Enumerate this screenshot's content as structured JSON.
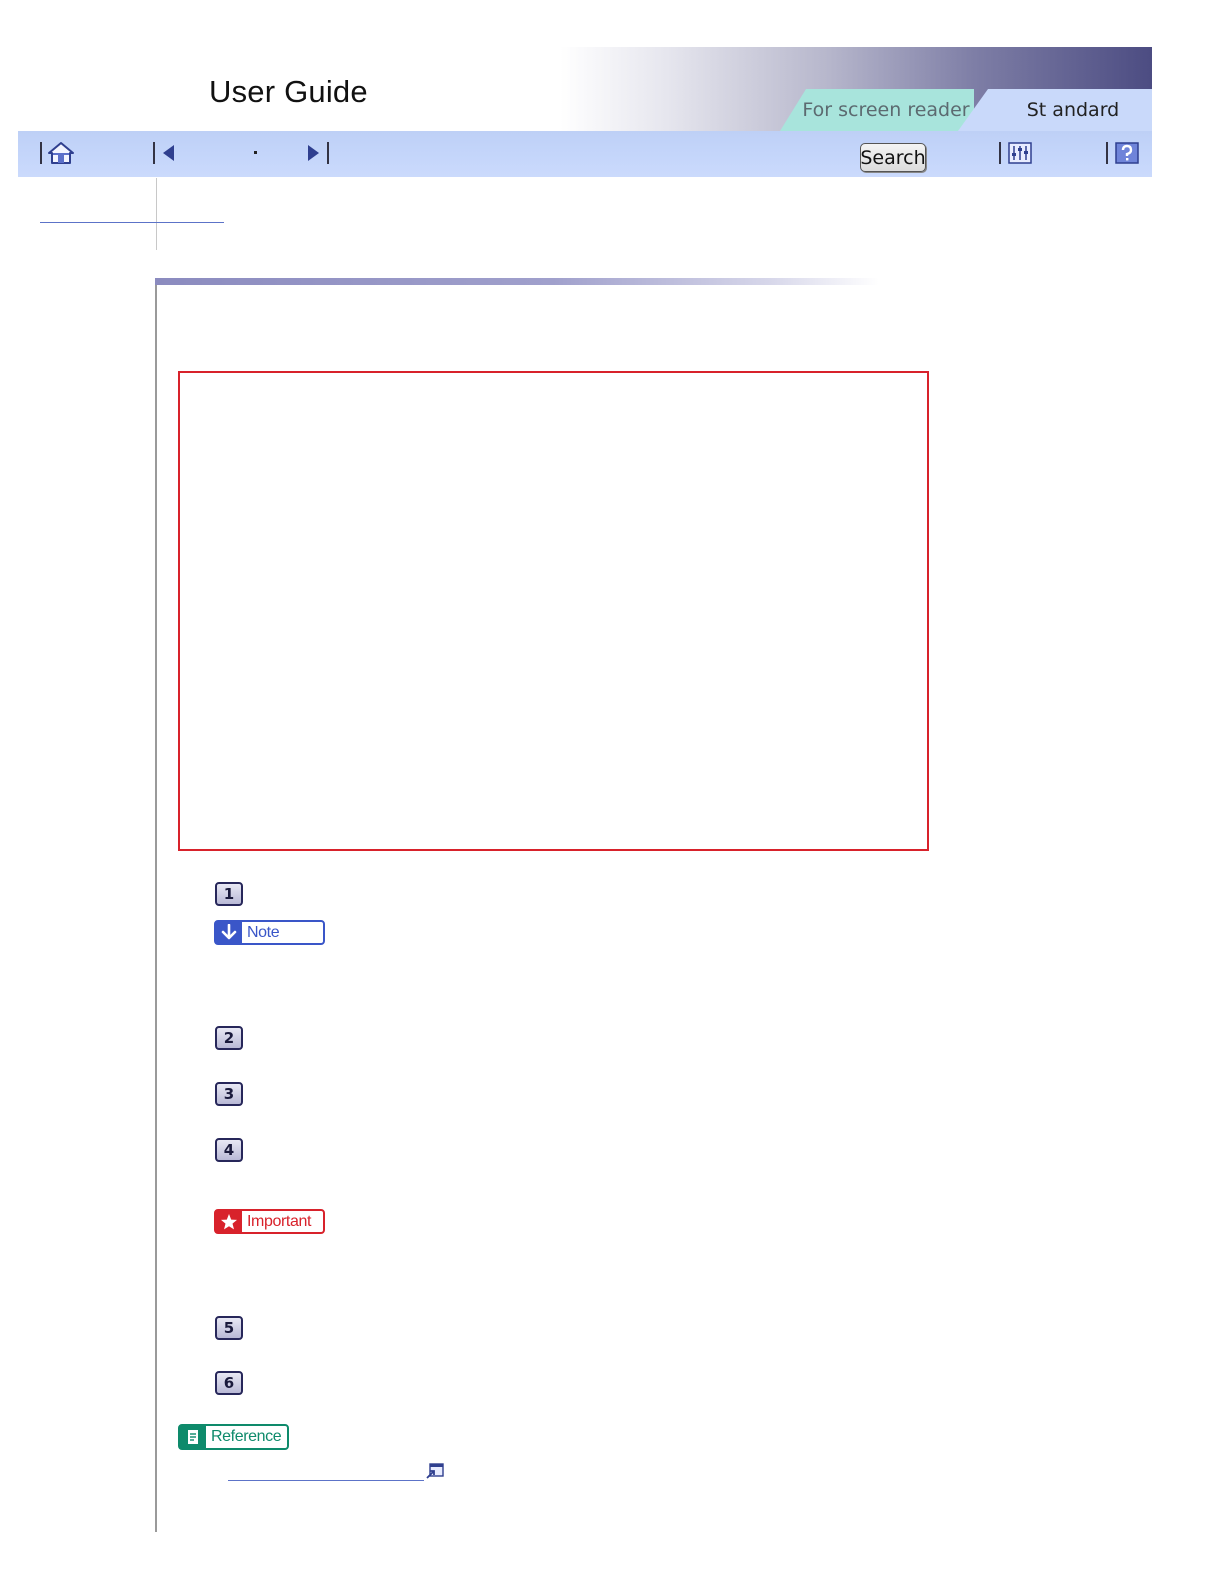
{
  "header": {
    "title": "User Guide",
    "tabs": [
      {
        "label": "For screen reader",
        "active": false
      },
      {
        "label": "St andard",
        "active": true
      }
    ]
  },
  "toolbar": {
    "icons": [
      "home-icon",
      "prev-page-icon",
      "next-page-icon",
      "settings-icon",
      "help-icon"
    ],
    "search_label": "Search"
  },
  "steps": [
    "1",
    "2",
    "3",
    "4",
    "5",
    "6"
  ],
  "labels": {
    "note": "Note",
    "important": "Important",
    "reference": "Reference"
  },
  "colors": {
    "frame_border": "#d8222b",
    "note": "#3a56c8",
    "important": "#d8222b",
    "reference": "#0e8a6b",
    "toolbar": "#c5d6fb"
  }
}
